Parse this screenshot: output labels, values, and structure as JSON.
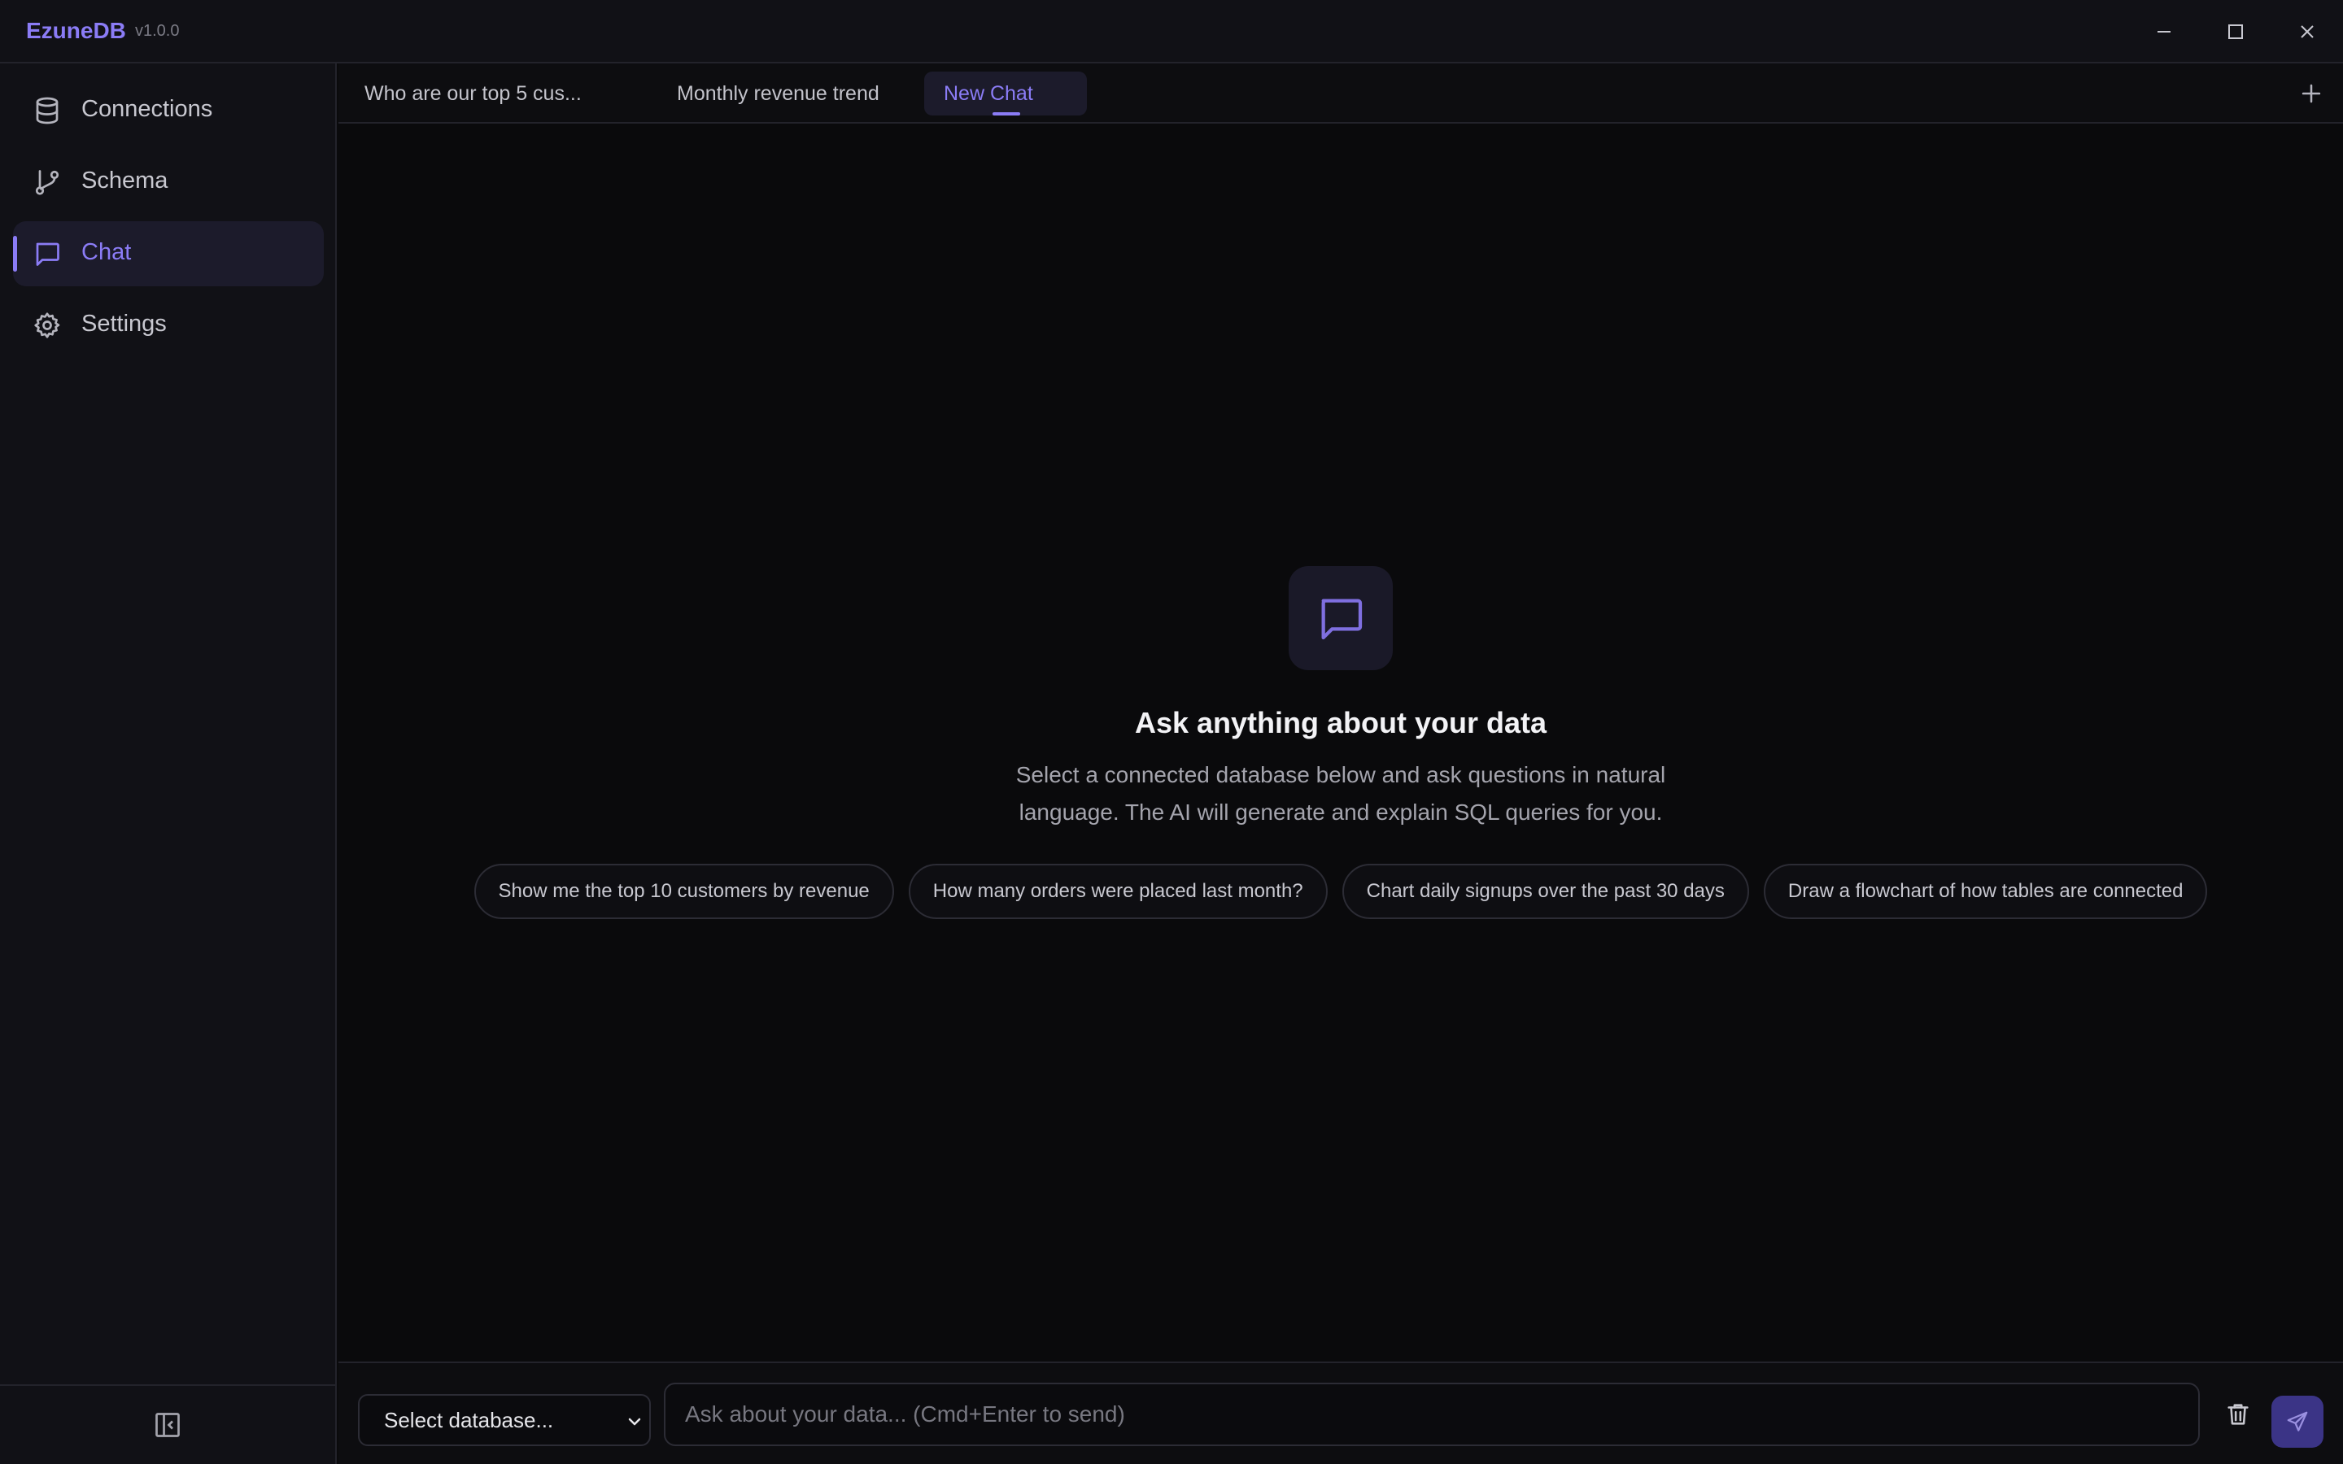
{
  "app": {
    "name": "EzuneDB",
    "version": "v1.0.0"
  },
  "window_controls": [
    "minimize-icon",
    "maximize-icon",
    "close-icon"
  ],
  "sidebar": {
    "items": [
      {
        "label": "Connections",
        "icon": "database-icon",
        "active": false
      },
      {
        "label": "Schema",
        "icon": "git-branch-icon",
        "active": false
      },
      {
        "label": "Chat",
        "icon": "message-square-icon",
        "active": true
      },
      {
        "label": "Settings",
        "icon": "gear-icon",
        "active": false
      }
    ],
    "footer_icon": "panel-collapse-icon"
  },
  "tabs": [
    {
      "label": "Who are our top 5 cus...",
      "active": false
    },
    {
      "label": "Monthly revenue trend",
      "active": false
    },
    {
      "label": "New Chat",
      "active": true
    }
  ],
  "empty_state": {
    "icon": "message-square-icon",
    "title": "Ask anything about your data",
    "description": "Select a connected database below and ask questions in natural language. The AI will generate and explain SQL queries for you.",
    "suggestions": [
      "Show me the top 10 customers by revenue",
      "How many orders were placed last month?",
      "Chart daily signups over the past 30 days",
      "Draw a flowchart of how tables are connected"
    ]
  },
  "composer": {
    "database_select": "Select database...",
    "input_placeholder": "Ask about your data... (Cmd+Enter to send)",
    "input_value": ""
  },
  "colors": {
    "accent": "#8b7cf6",
    "background": "#0a0a0c",
    "sidebar": "#111116",
    "send_button": "#3b3486"
  }
}
